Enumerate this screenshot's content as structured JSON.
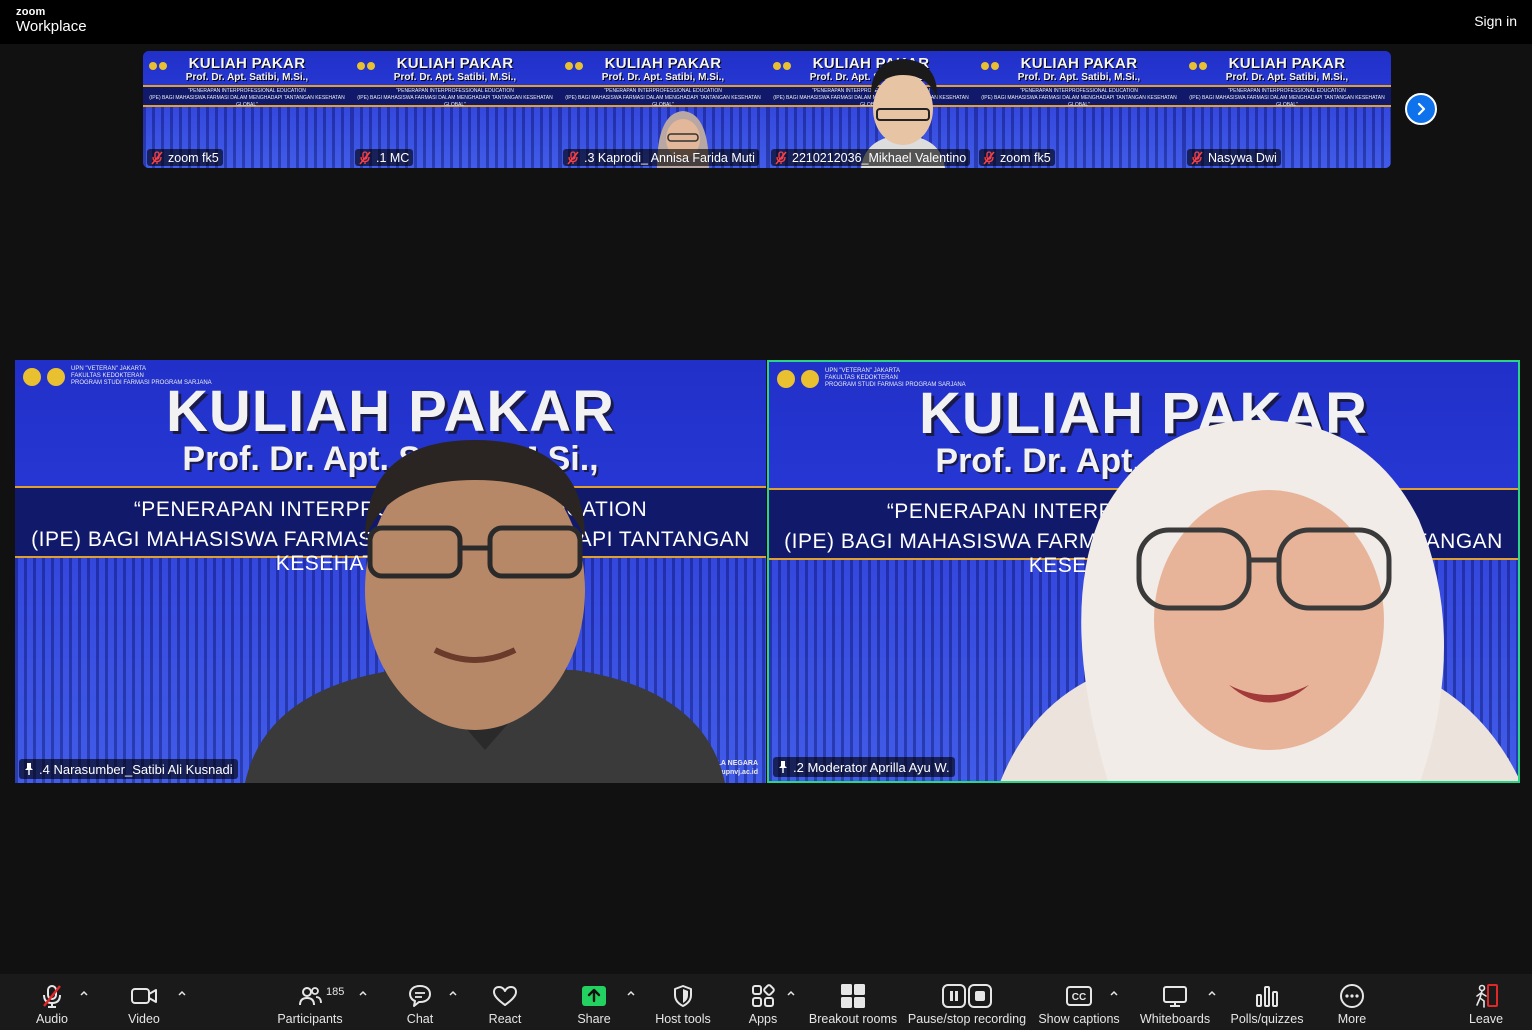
{
  "app": {
    "brand_top": "zoom",
    "brand_bottom": "Workplace",
    "signin_label": "Sign in"
  },
  "slide": {
    "title_line1": "KULIAH PAKAR",
    "title_line2": "Prof. Dr. Apt. Satibi, M.Si.,",
    "quote_line1": "“PENERAPAN INTERPROFESSIONAL EDUCATION",
    "quote_line2": "(IPE) BAGI MAHASISWA FARMASI DALAM MENGHADAPI TANTANGAN KESEHATAN GLOBAL”",
    "header_line1": "UPN \"VETERAN\" JAKARTA",
    "header_line2": "FAKULTAS KEDOKTERAN",
    "header_line3": "PROGRAM STUDI FARMASI PROGRAM SARJANA",
    "footer_line1": "KAMPUS BELA NEGARA",
    "footer_line2": "fk.upnvj.ac.id"
  },
  "gallery": [
    {
      "name": "zoom fk5",
      "muted": true
    },
    {
      "name": ".1 MC",
      "muted": true
    },
    {
      "name": ".3 Kaprodi_ Annisa Farida Muti",
      "muted": true
    },
    {
      "name": "2210212036_Mikhael Valentino",
      "muted": true
    },
    {
      "name": "zoom fk5",
      "muted": true
    },
    {
      "name": "Nasywa Dwi",
      "muted": true
    }
  ],
  "main_tiles": [
    {
      "name": ".4 Narasumber_Satibi Ali Kusnadi",
      "active": false
    },
    {
      "name": ".2 Moderator Aprilla Ayu W.",
      "active": true
    }
  ],
  "toolbar": {
    "audio": "Audio",
    "video": "Video",
    "participants": "Participants",
    "participants_count": "185",
    "chat": "Chat",
    "react": "React",
    "share": "Share",
    "host_tools": "Host tools",
    "apps": "Apps",
    "breakout": "Breakout rooms",
    "recording": "Pause/stop recording",
    "captions": "Show captions",
    "whiteboards": "Whiteboards",
    "polls": "Polls/quizzes",
    "more": "More",
    "leave": "Leave"
  },
  "colors": {
    "accent_blue": "#0e72ed",
    "active_border": "#2ad589",
    "share_green": "#23d160",
    "leave_red": "#e02828",
    "slide_blue": "#2030c8"
  }
}
